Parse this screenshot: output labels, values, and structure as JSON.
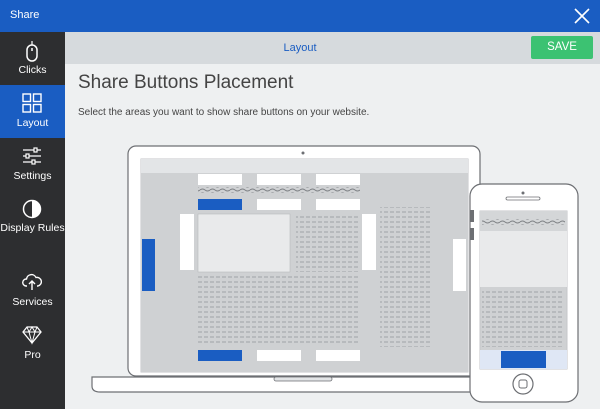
{
  "window": {
    "title": "Share",
    "close_icon": "close-icon"
  },
  "sidebar": {
    "items": [
      {
        "label": "Clicks",
        "icon": "mouse-icon",
        "active": false
      },
      {
        "label": "Layout",
        "icon": "layout-grid-icon",
        "active": true
      },
      {
        "label": "Settings",
        "icon": "sliders-icon",
        "active": false
      },
      {
        "label": "Display Rules",
        "icon": "half-circle-icon",
        "active": false
      },
      {
        "label": "Services",
        "icon": "cloud-upload-icon",
        "active": false
      },
      {
        "label": "Pro",
        "icon": "diamond-icon",
        "active": false
      }
    ]
  },
  "header": {
    "title": "Layout",
    "save_label": "SAVE"
  },
  "content": {
    "title": "Share Buttons Placement",
    "subtitle": "Select the areas you want to show share buttons on your website."
  },
  "colors": {
    "accent": "#1a5dc2",
    "save": "#3cc272",
    "sidebar": "#2d2e30"
  }
}
